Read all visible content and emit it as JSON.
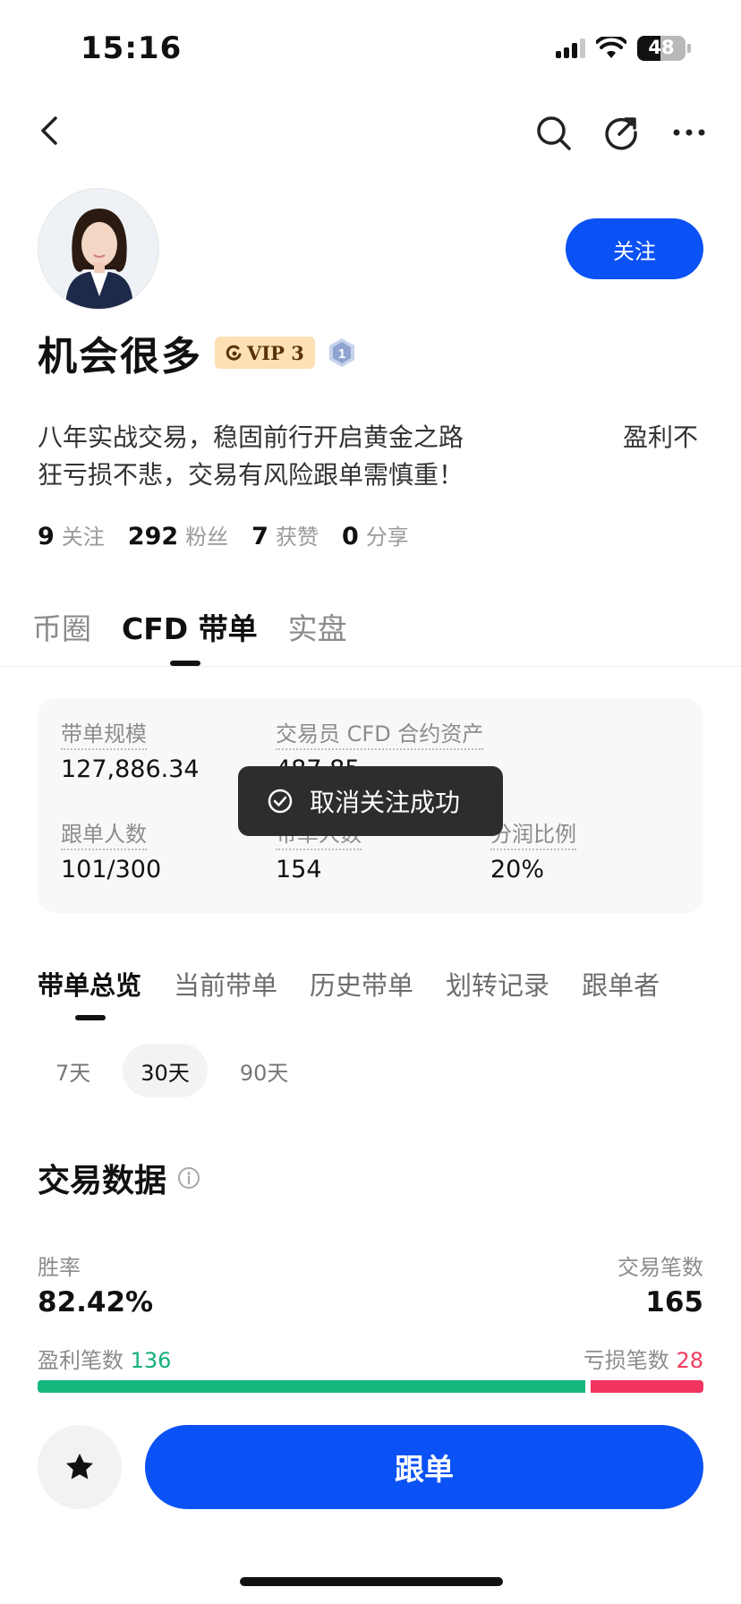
{
  "status_bar": {
    "time": "15:16",
    "battery": "48"
  },
  "nav": {
    "back_icon": "chevron-left-icon",
    "search_icon": "search-icon",
    "share_icon": "share-icon",
    "more_icon": "more-icon"
  },
  "profile": {
    "follow_label": "关注",
    "name": "机会很多",
    "vip": "VIP 3",
    "level": "1",
    "bio_line1": "八年实战交易，稳固前行开启黄金之路",
    "bio_line1_tail": "盈利不",
    "bio_line2": "狂亏损不悲，交易有风险跟单需慎重！"
  },
  "stats": [
    {
      "num": "9",
      "label": "关注"
    },
    {
      "num": "292",
      "label": "粉丝"
    },
    {
      "num": "7",
      "label": "获赞"
    },
    {
      "num": "0",
      "label": "分享"
    }
  ],
  "main_tabs": [
    "币圈",
    "CFD 带单",
    "实盘"
  ],
  "info_card": {
    "scale_label": "带单规模",
    "scale_value": "127,886.34",
    "assets_label": "交易员 CFD 合约资产",
    "assets_value": "487.85",
    "followers_label": "跟单人数",
    "followers_value": "101/300",
    "leaders_label": "带单人数",
    "leaders_value": "154",
    "profit_share_label": "分润比例",
    "profit_share_value": "20%"
  },
  "toast": {
    "text": "取消关注成功"
  },
  "sub_tabs": [
    "带单总览",
    "当前带单",
    "历史带单",
    "划转记录",
    "跟单者"
  ],
  "periods": [
    "7天",
    "30天",
    "90天"
  ],
  "trade_data": {
    "title": "交易数据",
    "win_rate_label": "胜率",
    "win_rate": "82.42%",
    "trades_label": "交易笔数",
    "trades": "165",
    "profit_label": "盈利笔数",
    "profit_count": "136",
    "loss_label": "亏损笔数",
    "loss_count": "28",
    "win_fraction": 0.8293
  },
  "bottom": {
    "follow_copy_label": "跟单",
    "fav_icon": "star-icon"
  },
  "colors": {
    "accent": "#0a52f5",
    "profit": "#14b07a",
    "loss": "#f03a5f"
  }
}
